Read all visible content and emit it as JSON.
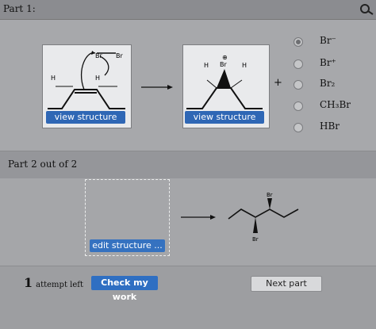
{
  "header": {
    "title": "Part 1:"
  },
  "part1": {
    "left_button": "view structure",
    "right_button": "view structure",
    "plus": "+",
    "left_labels": {
      "br1": "Br",
      "br2": "Br",
      "h1": "H",
      "h2": "H"
    },
    "right_labels": {
      "charge": "⊕",
      "br": "Br",
      "h1": "H",
      "h2": "H"
    },
    "options": [
      {
        "label": "Br⁻",
        "selected": true
      },
      {
        "label": "Br⁺",
        "selected": false
      },
      {
        "label": "Br₂",
        "selected": false
      },
      {
        "label": "CH₃Br",
        "selected": false
      },
      {
        "label": "HBr",
        "selected": false
      }
    ]
  },
  "part2": {
    "title": "Part 2 out of 2"
  },
  "workspace": {
    "edit_button": "edit structure ...",
    "product_labels": {
      "br_top": "Br",
      "br_bottom": "Br"
    }
  },
  "footer": {
    "attempts_count": "1",
    "attempts_text": "attempt left",
    "check_button": "Check my work",
    "next_button": "Next part"
  }
}
